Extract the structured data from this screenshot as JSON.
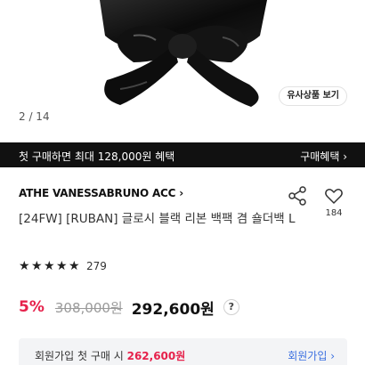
{
  "hero": {
    "similar_button": "유사상품 보기",
    "page_indicator": "2 / 14"
  },
  "promo": {
    "text": "첫 구매하면 최대 128,000원 혜택",
    "link": "구매혜택 ›"
  },
  "product": {
    "brand": "ATHE VANESSABRUNO ACC ›",
    "title": "[24FW] [RUBAN] 글로시 블랙 리본 백팩 겸 숄더백 L",
    "like_count": "184",
    "rating_stars": 5,
    "review_count": "279"
  },
  "price": {
    "discount": "5%",
    "original": "308,000원",
    "final": "292,600원",
    "help": "?"
  },
  "member": {
    "prefix": "회원가입 첫 구매 시",
    "price": "262,600원",
    "link": "회원가입 ›"
  },
  "colors": {
    "accent_red": "#e6214b",
    "link_blue": "#3b6fe0",
    "promo_bg": "#111111"
  },
  "icons": [
    "share-icon",
    "heart-icon",
    "star-icon",
    "help-icon"
  ]
}
